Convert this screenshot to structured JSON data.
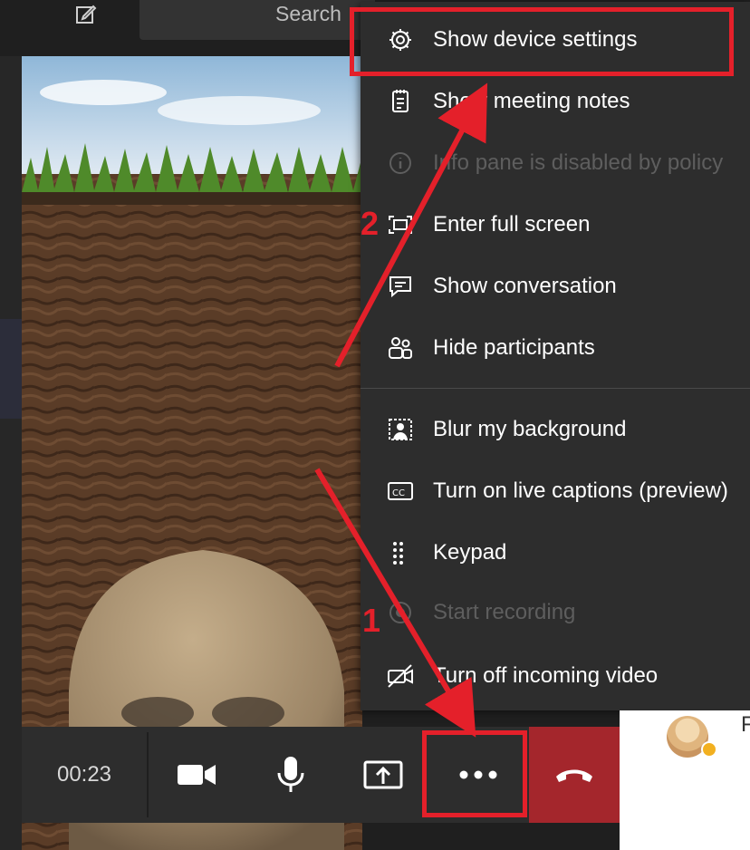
{
  "topbar": {
    "search_placeholder": "Search",
    "compose_icon": "compose-icon"
  },
  "menu": {
    "items": [
      {
        "label": "Show device settings",
        "icon": "gear-icon",
        "enabled": true
      },
      {
        "label": "Show meeting notes",
        "icon": "notes-icon",
        "enabled": true
      },
      {
        "label": "Info pane is disabled by policy",
        "icon": "info-icon",
        "enabled": false
      },
      {
        "label": "Enter full screen",
        "icon": "fullscreen-icon",
        "enabled": true
      },
      {
        "label": "Show conversation",
        "icon": "chat-icon",
        "enabled": true
      },
      {
        "label": "Hide participants",
        "icon": "participants-icon",
        "enabled": true
      },
      {
        "label": "Blur my background",
        "icon": "blur-icon",
        "enabled": true
      },
      {
        "label": "Turn on live captions (preview)",
        "icon": "captions-icon",
        "enabled": true
      },
      {
        "label": "Keypad",
        "icon": "keypad-icon",
        "enabled": true
      },
      {
        "label": "Start recording",
        "icon": "record-icon",
        "enabled": false
      },
      {
        "label": "Turn off incoming video",
        "icon": "video-off-icon",
        "enabled": true
      }
    ]
  },
  "callbar": {
    "timer": "00:23",
    "buttons": [
      "camera-icon",
      "mic-icon",
      "share-screen-icon",
      "more-options-icon",
      "hangup-icon"
    ]
  },
  "participant": {
    "initial": "F"
  },
  "annotations": {
    "step1": "1",
    "step2": "2"
  },
  "colors": {
    "highlight": "#e4202a",
    "hangup": "#a4262c",
    "menu_bg": "#2d2d2d"
  }
}
